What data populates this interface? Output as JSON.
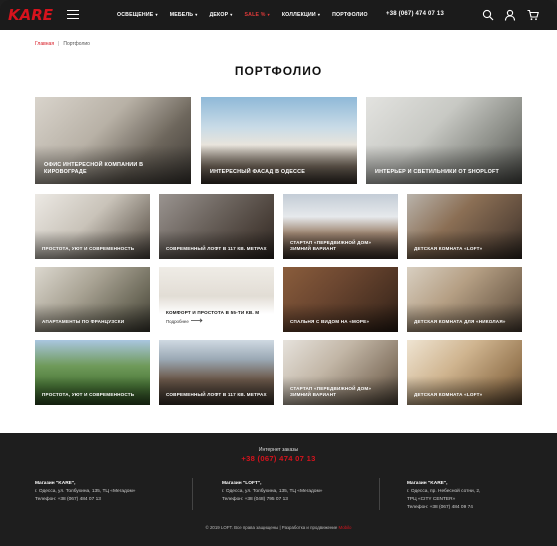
{
  "header": {
    "logo": "KARE",
    "nav": [
      {
        "label": "ОСВЕЩЕНИЕ",
        "caret": "▾"
      },
      {
        "label": "МЕБЕЛЬ",
        "caret": "▾"
      },
      {
        "label": "ДЕКОР",
        "caret": "▾"
      },
      {
        "label": "SALE %",
        "caret": "▾"
      },
      {
        "label": "КОЛЛЕКЦИИ",
        "caret": "▾"
      },
      {
        "label": "ПОРТФОЛИО",
        "caret": ""
      }
    ],
    "phone": "+38 (067) 474 07 13",
    "icons": [
      "search-icon",
      "user-icon",
      "cart-icon"
    ]
  },
  "breadcrumb": {
    "home": "Главная",
    "separator": "|",
    "current": "Портфолио"
  },
  "page_title": "ПОРТФОЛИО",
  "cards": [
    {
      "caption": "Офис интересной компании в Кировограде"
    },
    {
      "caption": "Интересный фасад в Одессе"
    },
    {
      "caption": "Интерьер и светильники от SHOPLOFT"
    },
    {
      "caption": "Простота, уют и современность"
    },
    {
      "caption": "Современный лофт в 117 кв. метрах"
    },
    {
      "caption": "Стартап «Передвижной дом» зимний вариант"
    },
    {
      "caption": "Детская комната «LOFT»"
    },
    {
      "caption": "Апартаменты по французски"
    },
    {
      "caption": "Комфорт и простота в 55-ти кв. м",
      "more": "Подробнее"
    },
    {
      "caption": "Спальня с видом на «море»"
    },
    {
      "caption": "Детская комната для «Николая»"
    },
    {
      "caption": "Простота, уют и современность"
    },
    {
      "caption": "Современный лофт в 117 кв. метрах"
    },
    {
      "caption": "Стартап «Передвижной дом» зимний вариант"
    },
    {
      "caption": "Детская комната «LOFT»"
    }
  ],
  "footer": {
    "orders_label": "Интернет заказы",
    "orders_phone": "+38 (067) 474 07 13",
    "stores": [
      {
        "name": "Магазин \"KARE\",",
        "address": "г. Одесса, ул. Толбухина, 135, ТЦ «Мегадом»",
        "phone": "Телефон: +38 (067) 484 07 13"
      },
      {
        "name": "Магазин \"LOFT\",",
        "address": "г. Одесса, ул. Толбухина, 135, ТЦ «Мегадом»",
        "phone": "Телефон: +38 (048) 795 07 13"
      },
      {
        "name": "Магазин \"KARE\",",
        "address": "г. Одесса, пр. Небесной сотни, 2,",
        "address2": "ТРЦ «CITY CENTER»",
        "phone": "Телефон: +38 (067) 484 09 74"
      }
    ],
    "copyright": "© 2019 LOFT. Все права защищены | Разработка и продвижение",
    "developer": "Mobilo"
  }
}
